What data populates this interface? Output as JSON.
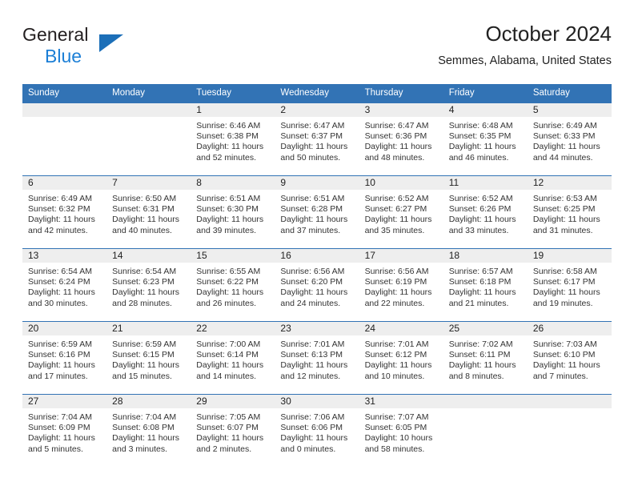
{
  "brand": {
    "line1": "General",
    "line2": "Blue",
    "triangle_color": "#1c6fb8",
    "blue_text_color": "#1c7fd6"
  },
  "header": {
    "title": "October 2024",
    "subtitle": "Semmes, Alabama, United States"
  },
  "theme": {
    "header_row_bg": "#3273b5",
    "daynum_band_bg": "#eeeeee",
    "row_separator": "#3273b5",
    "text": "#333333"
  },
  "labels": {
    "sunrise_prefix": "Sunrise: ",
    "sunset_prefix": "Sunset: ",
    "daylight_prefix": "Daylight: "
  },
  "weekday_headers": [
    "Sunday",
    "Monday",
    "Tuesday",
    "Wednesday",
    "Thursday",
    "Friday",
    "Saturday"
  ],
  "weeks": [
    [
      {
        "day": "",
        "empty": true
      },
      {
        "day": "",
        "empty": true
      },
      {
        "day": "1",
        "sunrise": "Sunrise: 6:46 AM",
        "sunset": "Sunset: 6:38 PM",
        "daylight_line1": "Daylight: 11 hours",
        "daylight_line2": "and 52 minutes."
      },
      {
        "day": "2",
        "sunrise": "Sunrise: 6:47 AM",
        "sunset": "Sunset: 6:37 PM",
        "daylight_line1": "Daylight: 11 hours",
        "daylight_line2": "and 50 minutes."
      },
      {
        "day": "3",
        "sunrise": "Sunrise: 6:47 AM",
        "sunset": "Sunset: 6:36 PM",
        "daylight_line1": "Daylight: 11 hours",
        "daylight_line2": "and 48 minutes."
      },
      {
        "day": "4",
        "sunrise": "Sunrise: 6:48 AM",
        "sunset": "Sunset: 6:35 PM",
        "daylight_line1": "Daylight: 11 hours",
        "daylight_line2": "and 46 minutes."
      },
      {
        "day": "5",
        "sunrise": "Sunrise: 6:49 AM",
        "sunset": "Sunset: 6:33 PM",
        "daylight_line1": "Daylight: 11 hours",
        "daylight_line2": "and 44 minutes."
      }
    ],
    [
      {
        "day": "6",
        "sunrise": "Sunrise: 6:49 AM",
        "sunset": "Sunset: 6:32 PM",
        "daylight_line1": "Daylight: 11 hours",
        "daylight_line2": "and 42 minutes."
      },
      {
        "day": "7",
        "sunrise": "Sunrise: 6:50 AM",
        "sunset": "Sunset: 6:31 PM",
        "daylight_line1": "Daylight: 11 hours",
        "daylight_line2": "and 40 minutes."
      },
      {
        "day": "8",
        "sunrise": "Sunrise: 6:51 AM",
        "sunset": "Sunset: 6:30 PM",
        "daylight_line1": "Daylight: 11 hours",
        "daylight_line2": "and 39 minutes."
      },
      {
        "day": "9",
        "sunrise": "Sunrise: 6:51 AM",
        "sunset": "Sunset: 6:28 PM",
        "daylight_line1": "Daylight: 11 hours",
        "daylight_line2": "and 37 minutes."
      },
      {
        "day": "10",
        "sunrise": "Sunrise: 6:52 AM",
        "sunset": "Sunset: 6:27 PM",
        "daylight_line1": "Daylight: 11 hours",
        "daylight_line2": "and 35 minutes."
      },
      {
        "day": "11",
        "sunrise": "Sunrise: 6:52 AM",
        "sunset": "Sunset: 6:26 PM",
        "daylight_line1": "Daylight: 11 hours",
        "daylight_line2": "and 33 minutes."
      },
      {
        "day": "12",
        "sunrise": "Sunrise: 6:53 AM",
        "sunset": "Sunset: 6:25 PM",
        "daylight_line1": "Daylight: 11 hours",
        "daylight_line2": "and 31 minutes."
      }
    ],
    [
      {
        "day": "13",
        "sunrise": "Sunrise: 6:54 AM",
        "sunset": "Sunset: 6:24 PM",
        "daylight_line1": "Daylight: 11 hours",
        "daylight_line2": "and 30 minutes."
      },
      {
        "day": "14",
        "sunrise": "Sunrise: 6:54 AM",
        "sunset": "Sunset: 6:23 PM",
        "daylight_line1": "Daylight: 11 hours",
        "daylight_line2": "and 28 minutes."
      },
      {
        "day": "15",
        "sunrise": "Sunrise: 6:55 AM",
        "sunset": "Sunset: 6:22 PM",
        "daylight_line1": "Daylight: 11 hours",
        "daylight_line2": "and 26 minutes."
      },
      {
        "day": "16",
        "sunrise": "Sunrise: 6:56 AM",
        "sunset": "Sunset: 6:20 PM",
        "daylight_line1": "Daylight: 11 hours",
        "daylight_line2": "and 24 minutes."
      },
      {
        "day": "17",
        "sunrise": "Sunrise: 6:56 AM",
        "sunset": "Sunset: 6:19 PM",
        "daylight_line1": "Daylight: 11 hours",
        "daylight_line2": "and 22 minutes."
      },
      {
        "day": "18",
        "sunrise": "Sunrise: 6:57 AM",
        "sunset": "Sunset: 6:18 PM",
        "daylight_line1": "Daylight: 11 hours",
        "daylight_line2": "and 21 minutes."
      },
      {
        "day": "19",
        "sunrise": "Sunrise: 6:58 AM",
        "sunset": "Sunset: 6:17 PM",
        "daylight_line1": "Daylight: 11 hours",
        "daylight_line2": "and 19 minutes."
      }
    ],
    [
      {
        "day": "20",
        "sunrise": "Sunrise: 6:59 AM",
        "sunset": "Sunset: 6:16 PM",
        "daylight_line1": "Daylight: 11 hours",
        "daylight_line2": "and 17 minutes."
      },
      {
        "day": "21",
        "sunrise": "Sunrise: 6:59 AM",
        "sunset": "Sunset: 6:15 PM",
        "daylight_line1": "Daylight: 11 hours",
        "daylight_line2": "and 15 minutes."
      },
      {
        "day": "22",
        "sunrise": "Sunrise: 7:00 AM",
        "sunset": "Sunset: 6:14 PM",
        "daylight_line1": "Daylight: 11 hours",
        "daylight_line2": "and 14 minutes."
      },
      {
        "day": "23",
        "sunrise": "Sunrise: 7:01 AM",
        "sunset": "Sunset: 6:13 PM",
        "daylight_line1": "Daylight: 11 hours",
        "daylight_line2": "and 12 minutes."
      },
      {
        "day": "24",
        "sunrise": "Sunrise: 7:01 AM",
        "sunset": "Sunset: 6:12 PM",
        "daylight_line1": "Daylight: 11 hours",
        "daylight_line2": "and 10 minutes."
      },
      {
        "day": "25",
        "sunrise": "Sunrise: 7:02 AM",
        "sunset": "Sunset: 6:11 PM",
        "daylight_line1": "Daylight: 11 hours",
        "daylight_line2": "and 8 minutes."
      },
      {
        "day": "26",
        "sunrise": "Sunrise: 7:03 AM",
        "sunset": "Sunset: 6:10 PM",
        "daylight_line1": "Daylight: 11 hours",
        "daylight_line2": "and 7 minutes."
      }
    ],
    [
      {
        "day": "27",
        "sunrise": "Sunrise: 7:04 AM",
        "sunset": "Sunset: 6:09 PM",
        "daylight_line1": "Daylight: 11 hours",
        "daylight_line2": "and 5 minutes."
      },
      {
        "day": "28",
        "sunrise": "Sunrise: 7:04 AM",
        "sunset": "Sunset: 6:08 PM",
        "daylight_line1": "Daylight: 11 hours",
        "daylight_line2": "and 3 minutes."
      },
      {
        "day": "29",
        "sunrise": "Sunrise: 7:05 AM",
        "sunset": "Sunset: 6:07 PM",
        "daylight_line1": "Daylight: 11 hours",
        "daylight_line2": "and 2 minutes."
      },
      {
        "day": "30",
        "sunrise": "Sunrise: 7:06 AM",
        "sunset": "Sunset: 6:06 PM",
        "daylight_line1": "Daylight: 11 hours",
        "daylight_line2": "and 0 minutes."
      },
      {
        "day": "31",
        "sunrise": "Sunrise: 7:07 AM",
        "sunset": "Sunset: 6:05 PM",
        "daylight_line1": "Daylight: 10 hours",
        "daylight_line2": "and 58 minutes."
      },
      {
        "day": "",
        "empty": true
      },
      {
        "day": "",
        "empty": true
      }
    ]
  ]
}
